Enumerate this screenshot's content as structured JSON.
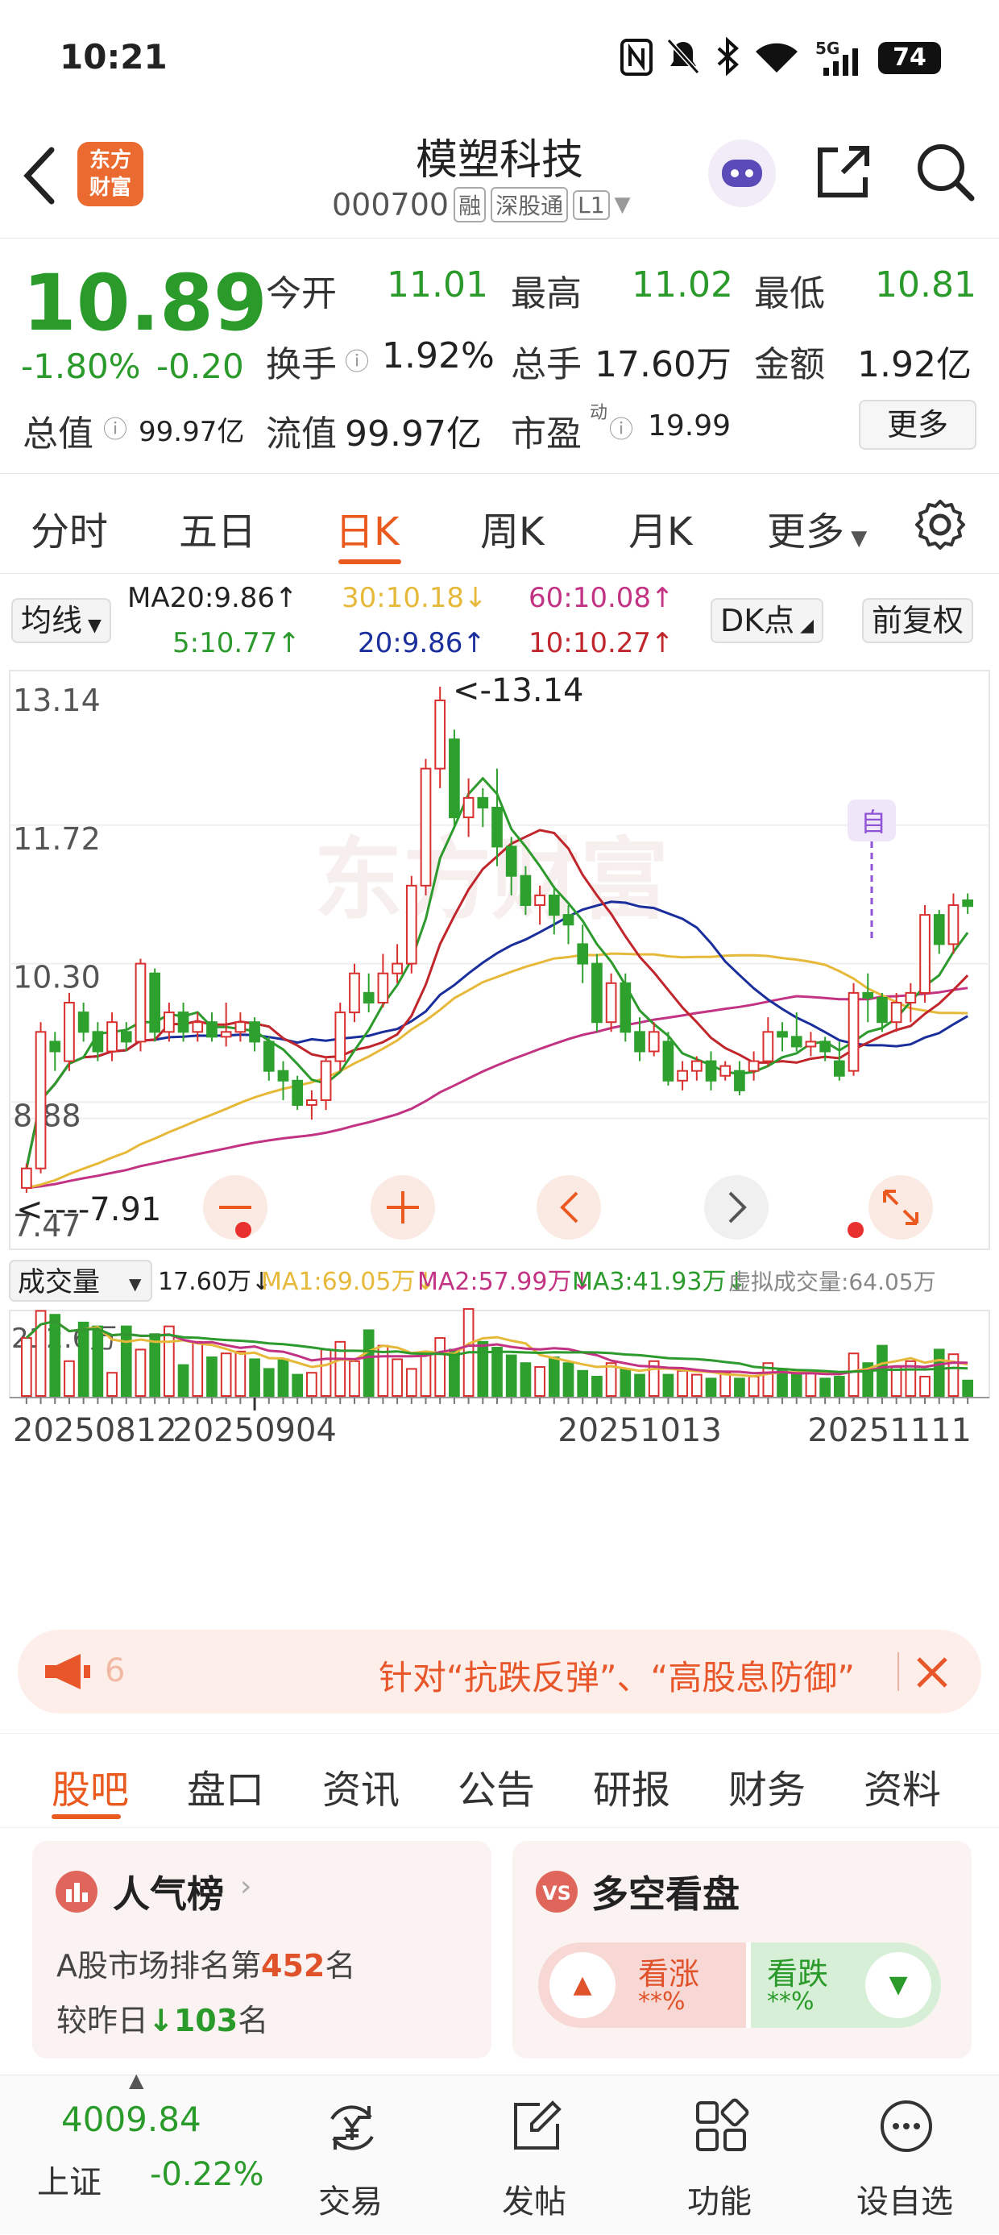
{
  "status": {
    "time": "10:21",
    "battery": "74",
    "network": "5G"
  },
  "header": {
    "title": "模塑科技",
    "code": "000700",
    "tags": [
      "融",
      "深股通",
      "L1"
    ],
    "logo_line1": "东方",
    "logo_line2": "财富"
  },
  "quote": {
    "price": "10.89",
    "change_pct": "-1.80%",
    "change": "-0.20",
    "open_label": "今开",
    "open": "11.01",
    "high_label": "最高",
    "high": "11.02",
    "low_label": "最低",
    "low": "10.81",
    "turnover_label": "换手",
    "turnover": "1.92%",
    "volume_label": "总手",
    "volume": "17.60万",
    "amount_label": "金额",
    "amount": "1.92亿",
    "mktcap_label": "总值",
    "mktcap": "99.97亿",
    "float_label": "流值",
    "float_cap": "99.97亿",
    "pe_label": "市盈",
    "pe_sup": "动",
    "pe": "19.99",
    "more": "更多"
  },
  "tabs": [
    "分时",
    "五日",
    "日K",
    "周K",
    "月K",
    "更多"
  ],
  "ma_bar": {
    "selector": "均线",
    "ma20_label": "MA20:9.86↑",
    "ma30": "30:10.18↓",
    "ma60": "60:10.08↑",
    "ma5": "5:10.77↑",
    "ma20": "20:9.86↑",
    "ma10": "10:10.27↑",
    "dk": "DK点",
    "adjust": "前复权"
  },
  "price_axis": {
    "labels": [
      "13.14",
      "11.72",
      "10.30",
      "8.88",
      "7.47"
    ],
    "max_marker": "<-13.14",
    "min_marker": "<----7.91",
    "self_tag": "自"
  },
  "vol_bar": {
    "selector": "成交量",
    "vol": "17.60万↓",
    "ma1": "MA1:69.05万↓",
    "ma2": "MA2:57.99万↓",
    "ma3": "MA3:41.93万↓",
    "virtual": "虚拟成交量:64.05万",
    "max": "212.6万"
  },
  "dates": [
    "20250812",
    "20250904",
    "20251013",
    "20251111"
  ],
  "banner": {
    "text": "针对“抗跌反弹”、“高股息防御”",
    "left": "6"
  },
  "subtabs": [
    "股吧",
    "盘口",
    "资讯",
    "公告",
    "研报",
    "财务",
    "资料"
  ],
  "card1": {
    "title": "人气榜",
    "line1_pre": "A股市场排名第",
    "rank": "452",
    "line1_post": "名",
    "line2_pre": "较昨日",
    "change": "103",
    "line2_post": "名"
  },
  "card2": {
    "title": "多空看盘",
    "up_label": "看涨",
    "up_val": "**%",
    "down_label": "看跌",
    "down_val": "**%"
  },
  "bottom": {
    "index_value": "4009.84",
    "index_name": "上证",
    "index_change": "-0.22%",
    "items": [
      "交易",
      "发帖",
      "功能",
      "设自选"
    ]
  },
  "chart_data": {
    "type": "candlestick",
    "y_range": [
      7.47,
      13.14
    ],
    "colors": {
      "up": "#d8302f",
      "down": "#2ea02e",
      "ma5": "#2c9a2c",
      "ma10": "#c0262b",
      "ma20": "#1b2f9c",
      "ma30": "#e6b93a",
      "ma60": "#c33383"
    },
    "candles": [
      [
        8.0,
        8.2,
        7.95,
        8.25
      ],
      [
        8.2,
        9.6,
        8.15,
        9.7
      ],
      [
        9.5,
        9.4,
        9.2,
        9.6
      ],
      [
        9.3,
        9.9,
        9.2,
        10.0
      ],
      [
        9.8,
        9.6,
        9.5,
        9.9
      ],
      [
        9.6,
        9.4,
        9.3,
        9.7
      ],
      [
        9.4,
        9.7,
        9.3,
        9.8
      ],
      [
        9.6,
        9.5,
        9.4,
        9.7
      ],
      [
        9.5,
        10.3,
        9.4,
        10.35
      ],
      [
        10.2,
        9.6,
        9.5,
        10.25
      ],
      [
        9.6,
        9.8,
        9.5,
        9.9
      ],
      [
        9.8,
        9.6,
        9.5,
        9.9
      ],
      [
        9.6,
        9.7,
        9.5,
        9.8
      ],
      [
        9.7,
        9.55,
        9.5,
        9.8
      ],
      [
        9.55,
        9.6,
        9.45,
        9.9
      ],
      [
        9.6,
        9.7,
        9.5,
        9.8
      ],
      [
        9.7,
        9.5,
        9.4,
        9.75
      ],
      [
        9.5,
        9.2,
        9.1,
        9.55
      ],
      [
        9.2,
        9.1,
        8.9,
        9.3
      ],
      [
        9.1,
        8.85,
        8.8,
        9.15
      ],
      [
        8.85,
        8.9,
        8.7,
        9.0
      ],
      [
        8.9,
        9.3,
        8.8,
        9.35
      ],
      [
        9.3,
        9.8,
        9.2,
        9.9
      ],
      [
        9.8,
        10.2,
        9.7,
        10.3
      ],
      [
        10.0,
        9.9,
        9.8,
        10.2
      ],
      [
        9.9,
        10.2,
        9.85,
        10.4
      ],
      [
        10.2,
        10.3,
        10.1,
        10.5
      ],
      [
        10.3,
        11.1,
        10.2,
        11.2
      ],
      [
        11.1,
        12.3,
        11.0,
        12.4
      ],
      [
        12.3,
        13.0,
        12.1,
        13.14
      ],
      [
        12.6,
        11.8,
        11.7,
        12.7
      ],
      [
        11.8,
        12.0,
        11.6,
        12.2
      ],
      [
        12.0,
        11.9,
        11.7,
        12.1
      ],
      [
        11.9,
        11.5,
        11.3,
        12.3
      ],
      [
        11.5,
        11.2,
        11.0,
        11.6
      ],
      [
        11.2,
        10.9,
        10.8,
        11.3
      ],
      [
        10.9,
        11.0,
        10.7,
        11.1
      ],
      [
        11.0,
        10.8,
        10.6,
        11.1
      ],
      [
        10.8,
        10.7,
        10.5,
        10.9
      ],
      [
        10.5,
        10.3,
        10.1,
        10.7
      ],
      [
        10.3,
        9.7,
        9.6,
        10.4
      ],
      [
        9.7,
        10.1,
        9.6,
        10.2
      ],
      [
        10.1,
        9.6,
        9.5,
        10.2
      ],
      [
        9.6,
        9.4,
        9.3,
        9.75
      ],
      [
        9.4,
        9.6,
        9.35,
        9.7
      ],
      [
        9.5,
        9.1,
        9.05,
        9.6
      ],
      [
        9.1,
        9.2,
        9.0,
        9.3
      ],
      [
        9.2,
        9.3,
        9.1,
        9.35
      ],
      [
        9.3,
        9.1,
        9.0,
        9.4
      ],
      [
        9.15,
        9.25,
        9.1,
        9.3
      ],
      [
        9.2,
        9.0,
        8.95,
        9.3
      ],
      [
        9.2,
        9.3,
        9.1,
        9.4
      ],
      [
        9.3,
        9.6,
        9.25,
        9.75
      ],
      [
        9.6,
        9.55,
        9.4,
        9.7
      ],
      [
        9.55,
        9.45,
        9.4,
        9.8
      ],
      [
        9.45,
        9.5,
        9.35,
        9.6
      ],
      [
        9.5,
        9.4,
        9.3,
        9.55
      ],
      [
        9.3,
        9.15,
        9.1,
        9.5
      ],
      [
        9.2,
        10.0,
        9.15,
        10.1
      ],
      [
        10.0,
        9.95,
        9.7,
        10.2
      ],
      [
        9.95,
        9.7,
        9.6,
        10.0
      ],
      [
        9.7,
        9.9,
        9.6,
        10.0
      ],
      [
        9.9,
        10.0,
        9.7,
        10.1
      ],
      [
        10.0,
        10.8,
        9.9,
        10.9
      ],
      [
        10.8,
        10.5,
        10.4,
        10.85
      ],
      [
        10.5,
        10.9,
        10.4,
        11.02
      ],
      [
        10.95,
        10.89,
        10.81,
        11.02
      ]
    ],
    "volumes": [
      150,
      220,
      210,
      90,
      190,
      180,
      60,
      180,
      120,
      160,
      180,
      80,
      140,
      100,
      110,
      115,
      95,
      70,
      95,
      55,
      60,
      120,
      140,
      90,
      170,
      130,
      95,
      70,
      110,
      150,
      120,
      225,
      140,
      125,
      105,
      85,
      75,
      100,
      85,
      65,
      50,
      85,
      70,
      55,
      90,
      55,
      65,
      55,
      45,
      60,
      45,
      50,
      85,
      70,
      55,
      60,
      45,
      50,
      110,
      85,
      130,
      75,
      90,
      50,
      120,
      108,
      40
    ],
    "vol_max": 212.6,
    "dates": [
      "20250812",
      "20250904",
      "20251013",
      "20251111"
    ]
  }
}
